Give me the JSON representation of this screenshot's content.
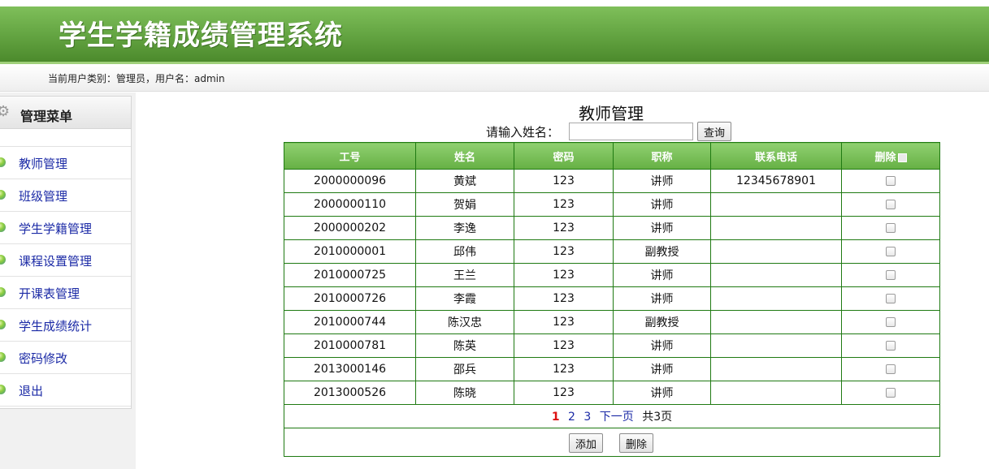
{
  "header": {
    "title": "学生学籍成绩管理系统"
  },
  "userbar": {
    "text": "当前用户类别：管理员，用户名：admin"
  },
  "sidebar": {
    "title": "管理菜单",
    "items": [
      {
        "label": "教师管理"
      },
      {
        "label": "班级管理"
      },
      {
        "label": "学生学籍管理"
      },
      {
        "label": "课程设置管理"
      },
      {
        "label": "开课表管理"
      },
      {
        "label": "学生成绩统计"
      },
      {
        "label": "密码修改"
      },
      {
        "label": "退出"
      }
    ]
  },
  "main": {
    "title": "教师管理",
    "search": {
      "label": "请输入姓名：",
      "value": "",
      "button": "查询"
    },
    "table": {
      "headers": [
        "工号",
        "姓名",
        "密码",
        "职称",
        "联系电话",
        "删除"
      ],
      "rows": [
        {
          "id": "2000000096",
          "name": "黄斌",
          "password": "123",
          "title": "讲师",
          "phone": "12345678901"
        },
        {
          "id": "2000000110",
          "name": "贺娟",
          "password": "123",
          "title": "讲师",
          "phone": ""
        },
        {
          "id": "2000000202",
          "name": "李逸",
          "password": "123",
          "title": "讲师",
          "phone": ""
        },
        {
          "id": "2010000001",
          "name": "邱伟",
          "password": "123",
          "title": "副教授",
          "phone": ""
        },
        {
          "id": "2010000725",
          "name": "王兰",
          "password": "123",
          "title": "讲师",
          "phone": ""
        },
        {
          "id": "2010000726",
          "name": "李霞",
          "password": "123",
          "title": "讲师",
          "phone": ""
        },
        {
          "id": "2010000744",
          "name": "陈汉忠",
          "password": "123",
          "title": "副教授",
          "phone": ""
        },
        {
          "id": "2010000781",
          "name": "陈英",
          "password": "123",
          "title": "讲师",
          "phone": ""
        },
        {
          "id": "2013000146",
          "name": "邵兵",
          "password": "123",
          "title": "讲师",
          "phone": ""
        },
        {
          "id": "2013000526",
          "name": "陈晓",
          "password": "123",
          "title": "讲师",
          "phone": ""
        }
      ]
    },
    "pager": {
      "current": "1",
      "pages": [
        "2",
        "3"
      ],
      "next": "下一页",
      "total": "共3页"
    },
    "actions": {
      "add": "添加",
      "delete": "删除"
    }
  }
}
